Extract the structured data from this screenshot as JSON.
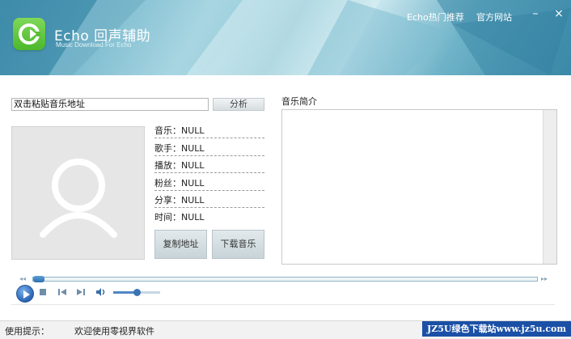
{
  "app": {
    "title": "Echo 回声辅助",
    "subtitle": "Music Download For Echo"
  },
  "header": {
    "links": [
      "Echo热门推荐",
      "官方网站"
    ],
    "min_symbol": "–",
    "close_symbol": "×"
  },
  "main": {
    "url_value": "双击粘贴音乐地址",
    "analyze_label": "分析",
    "info": [
      {
        "key": "音乐：",
        "value": "NULL"
      },
      {
        "key": "歌手：",
        "value": "NULL"
      },
      {
        "key": "播放：",
        "value": "NULL"
      },
      {
        "key": "粉丝：",
        "value": "NULL"
      },
      {
        "key": "分享：",
        "value": "NULL"
      },
      {
        "key": "时间：",
        "value": "NULL"
      }
    ],
    "copy_label": "复制地址",
    "download_label": "下载音乐",
    "intro_title": "音乐简介",
    "intro_text": ""
  },
  "player": {
    "progress": 0,
    "volume": 0.5,
    "icons": [
      "play-icon",
      "stop-icon",
      "previous-icon",
      "next-icon",
      "volume-icon"
    ]
  },
  "status": {
    "label": "使用提示：",
    "message": "欢迎使用零视界软件"
  },
  "watermark": "JZ5U绿色下载站www.jz5u.com",
  "colors": {
    "header_blue": "#5fa9c2",
    "logo_green": "#4cb82c",
    "play_blue": "#2a62b5",
    "watermark_bg": "#1a50a6"
  }
}
